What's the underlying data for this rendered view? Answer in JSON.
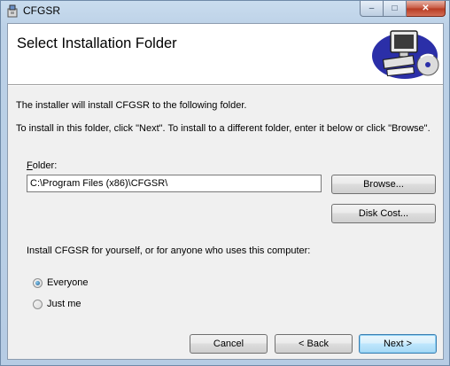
{
  "window": {
    "title": "CFGSR",
    "minimize_glyph": "–",
    "maximize_glyph": "□",
    "close_glyph": "✕"
  },
  "banner": {
    "title": "Select Installation Folder",
    "art_icon": "computer-with-cd-icon"
  },
  "body": {
    "intro": "The installer will install CFGSR to the following folder.",
    "instructions": "To install in this folder, click \"Next\". To install to a different folder, enter it below or click \"Browse\".",
    "folder_label_accel": "F",
    "folder_label_rest": "older:",
    "folder_value": "C:\\Program Files (x86)\\CFGSR\\",
    "browse_label": "Browse...",
    "disk_cost_label": "Disk Cost...",
    "install_for_prompt": "Install CFGSR for yourself, or for anyone who uses this computer:",
    "radio_options": [
      {
        "label": "Everyone",
        "checked": true
      },
      {
        "label": "Just me",
        "checked": false
      }
    ]
  },
  "footer": {
    "cancel_label": "Cancel",
    "back_label": "< Back",
    "next_label": "Next >"
  }
}
